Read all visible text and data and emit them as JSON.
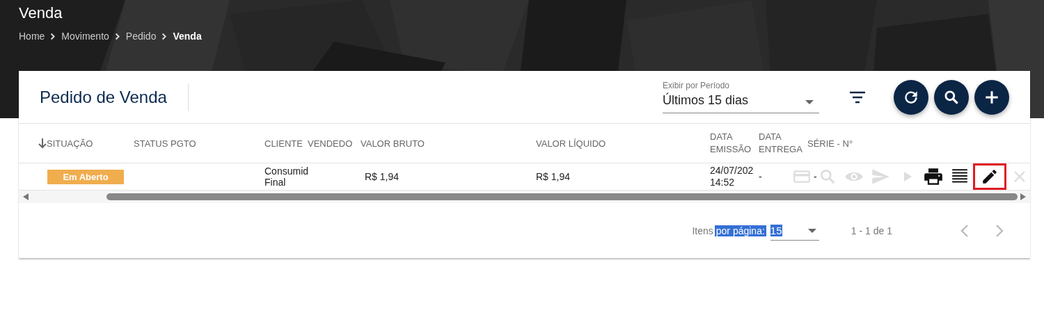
{
  "page": {
    "title": "Venda",
    "breadcrumb": [
      {
        "label": "Home",
        "current": false
      },
      {
        "label": "Movimento",
        "current": false
      },
      {
        "label": "Pedido",
        "current": false
      },
      {
        "label": "Venda",
        "current": true
      }
    ]
  },
  "card": {
    "title": "Pedido de Venda",
    "period": {
      "label": "Exibir por Período",
      "value": "Últimos 15 dias"
    },
    "fab_buttons": [
      {
        "kind": "refresh"
      },
      {
        "kind": "search"
      },
      {
        "kind": "add"
      }
    ]
  },
  "table": {
    "columns": [
      {
        "label": "SITUAÇÃO",
        "sorted": true
      },
      {
        "label": "STATUS PGTO",
        "sorted": false
      },
      {
        "label": "CLIENTE",
        "sorted": false
      },
      {
        "label": "VENDEDO",
        "sorted": false
      },
      {
        "label": "VALOR BRUTO",
        "sorted": false
      },
      {
        "label": "VALOR LÍQUIDO",
        "sorted": false
      },
      {
        "label": "DATA EMISSÃO",
        "sorted": false
      },
      {
        "label": "DATA ENTREGA",
        "sorted": false
      },
      {
        "label": "SÉRIE - N°",
        "sorted": false
      }
    ],
    "rows": [
      {
        "situacao": {
          "text": "Em Aberto",
          "color": "#f0ad4e"
        },
        "cliente": "Consumid Final",
        "valor_bruto": "R$ 1,94",
        "valor_liquido": "R$ 1,94",
        "data_emissao": "24/07/202 14:52",
        "data_entrega": "-",
        "serie": "-",
        "actions": [
          {
            "kind": "card",
            "disabled": true,
            "highlighted": false
          },
          {
            "kind": "search",
            "disabled": true,
            "highlighted": false
          },
          {
            "kind": "eye",
            "disabled": true,
            "highlighted": false
          },
          {
            "kind": "send",
            "disabled": true,
            "highlighted": false
          },
          {
            "kind": "play",
            "disabled": true,
            "highlighted": false
          },
          {
            "kind": "print",
            "disabled": false,
            "highlighted": false
          },
          {
            "kind": "lines",
            "disabled": false,
            "highlighted": false
          },
          {
            "kind": "edit",
            "disabled": false,
            "highlighted": true
          },
          {
            "kind": "close",
            "disabled": true,
            "highlighted": false
          }
        ]
      }
    ]
  },
  "pagination": {
    "label": [
      {
        "text": "Itens",
        "highlighted": false
      },
      {
        "text": "por página:",
        "highlighted": true
      }
    ],
    "page_size": {
      "value": "15",
      "highlighted": true
    },
    "range": "1 - 1 de 1"
  }
}
